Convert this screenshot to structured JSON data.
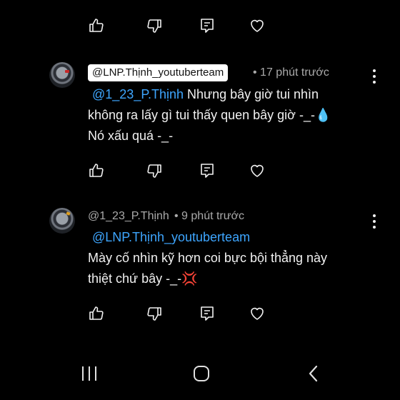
{
  "comments": [
    {
      "author": "@LNP.Thịnh_youtuberteam",
      "time": "• 17 phút trước",
      "mention": "@1_23_P.Thịnh",
      "line1_rest": " Nhưng bây giờ tui nhìn",
      "line2": "không ra lấy gì tui thấy quen bây giờ -_-💧",
      "line3": "Nó xấu quá -_-"
    },
    {
      "author": "@1_23_P.Thịnh",
      "time": "• 9 phút trước",
      "mention": "@LNP.Thịnh_youtuberteam",
      "line2": "Mày cố nhìn kỹ hơn coi bực bội thẳng này",
      "line3": "thiệt chứ bây -_-💢"
    }
  ],
  "icons": {
    "like": "thumbs-up-icon",
    "dislike": "thumbs-down-icon",
    "reply": "reply-icon",
    "heart": "heart-icon",
    "more": "more-vert-icon"
  },
  "colors": {
    "background": "#000000",
    "text": "#f1f1f1",
    "meta": "#aaaaaa",
    "mention": "#3ea6ff"
  }
}
